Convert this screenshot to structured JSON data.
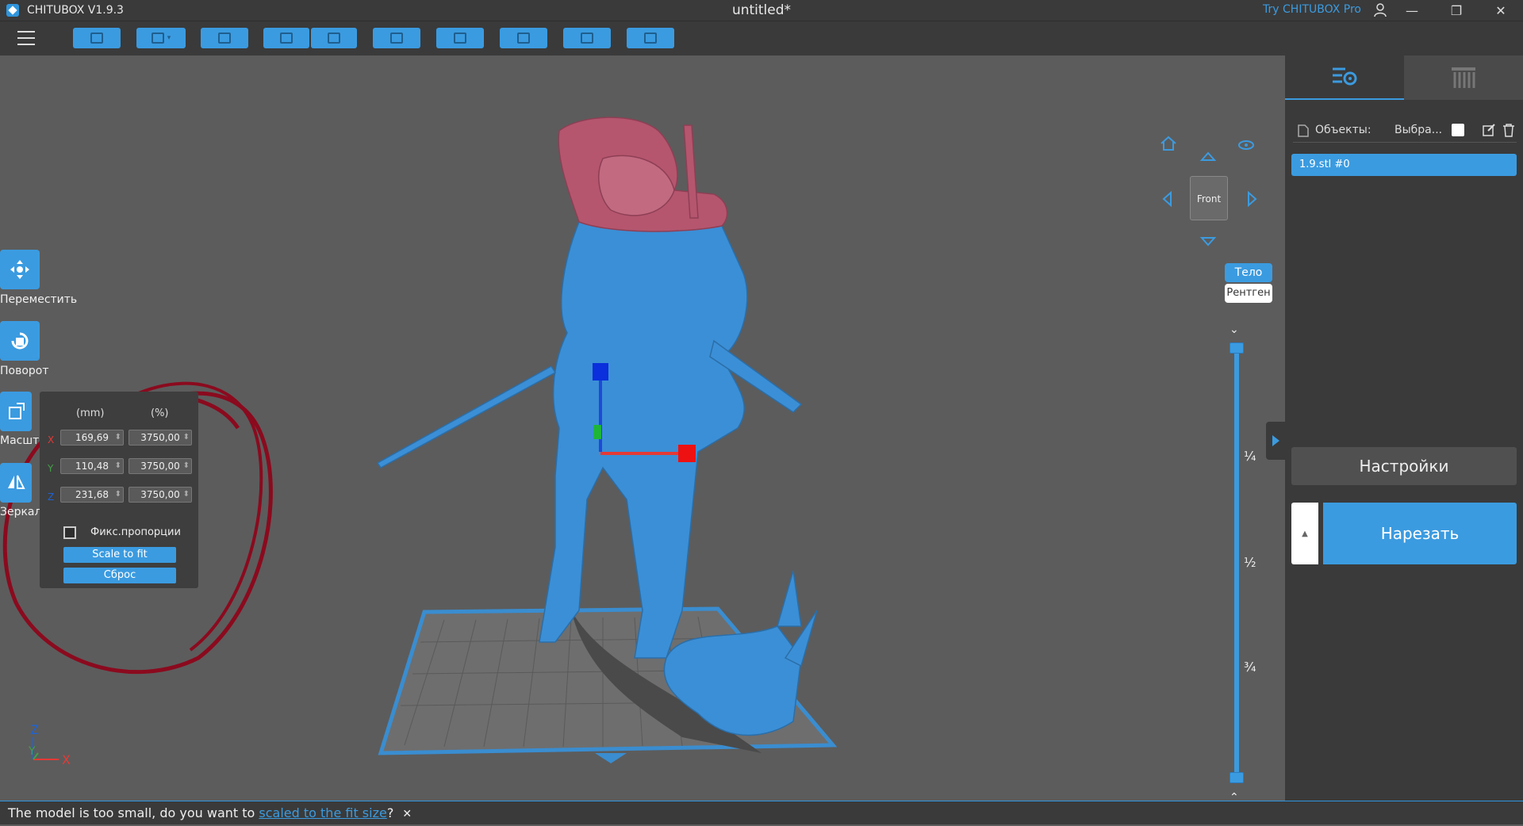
{
  "window": {
    "app_name": "CHITUBOX V1.9.3",
    "doc_title": "untitled*",
    "try_pro": "Try CHITUBOX Pro"
  },
  "tools": [
    {
      "label": "Переместить"
    },
    {
      "label": "Поворот"
    },
    {
      "label": "Масштаб"
    },
    {
      "label": "Зеркало"
    }
  ],
  "scale_panel": {
    "col_mm": "(mm)",
    "col_pct": "(%)",
    "rows": [
      {
        "axis": "X",
        "mm": "169,69",
        "pct": "3750,00",
        "color": "#e53935"
      },
      {
        "axis": "Y",
        "mm": "110,48",
        "pct": "3750,00",
        "color": "#43a047"
      },
      {
        "axis": "Z",
        "mm": "231,68",
        "pct": "3750,00",
        "color": "#1e63d6"
      }
    ],
    "fix_label": "Фикс.пропорции",
    "fix_checked": false,
    "scale_to_fit": "Scale to fit",
    "reset": "Сброс"
  },
  "view": {
    "cube_face": "Front",
    "mode_body": "Тело",
    "mode_xray": "Рентген",
    "fractions": [
      "¼",
      "½",
      "¾"
    ],
    "gizmo_labels": {
      "z": "Z",
      "y": "Y",
      "x": "X"
    }
  },
  "right_panel": {
    "objects_label": "Объекты:",
    "select_label": "Выбра...",
    "object_item": "1.9.stl #0",
    "settings_button": "Настройки",
    "slice_button": "Нарезать"
  },
  "status": {
    "prefix": "The model is too small, do you want to ",
    "link": "scaled to the fit size",
    "suffix": "?"
  },
  "colors": {
    "accent": "#3b9be0",
    "annotation_circle": "#8b0a1e",
    "model_blue": "#3b8fd6",
    "model_red": "#b5566e"
  }
}
